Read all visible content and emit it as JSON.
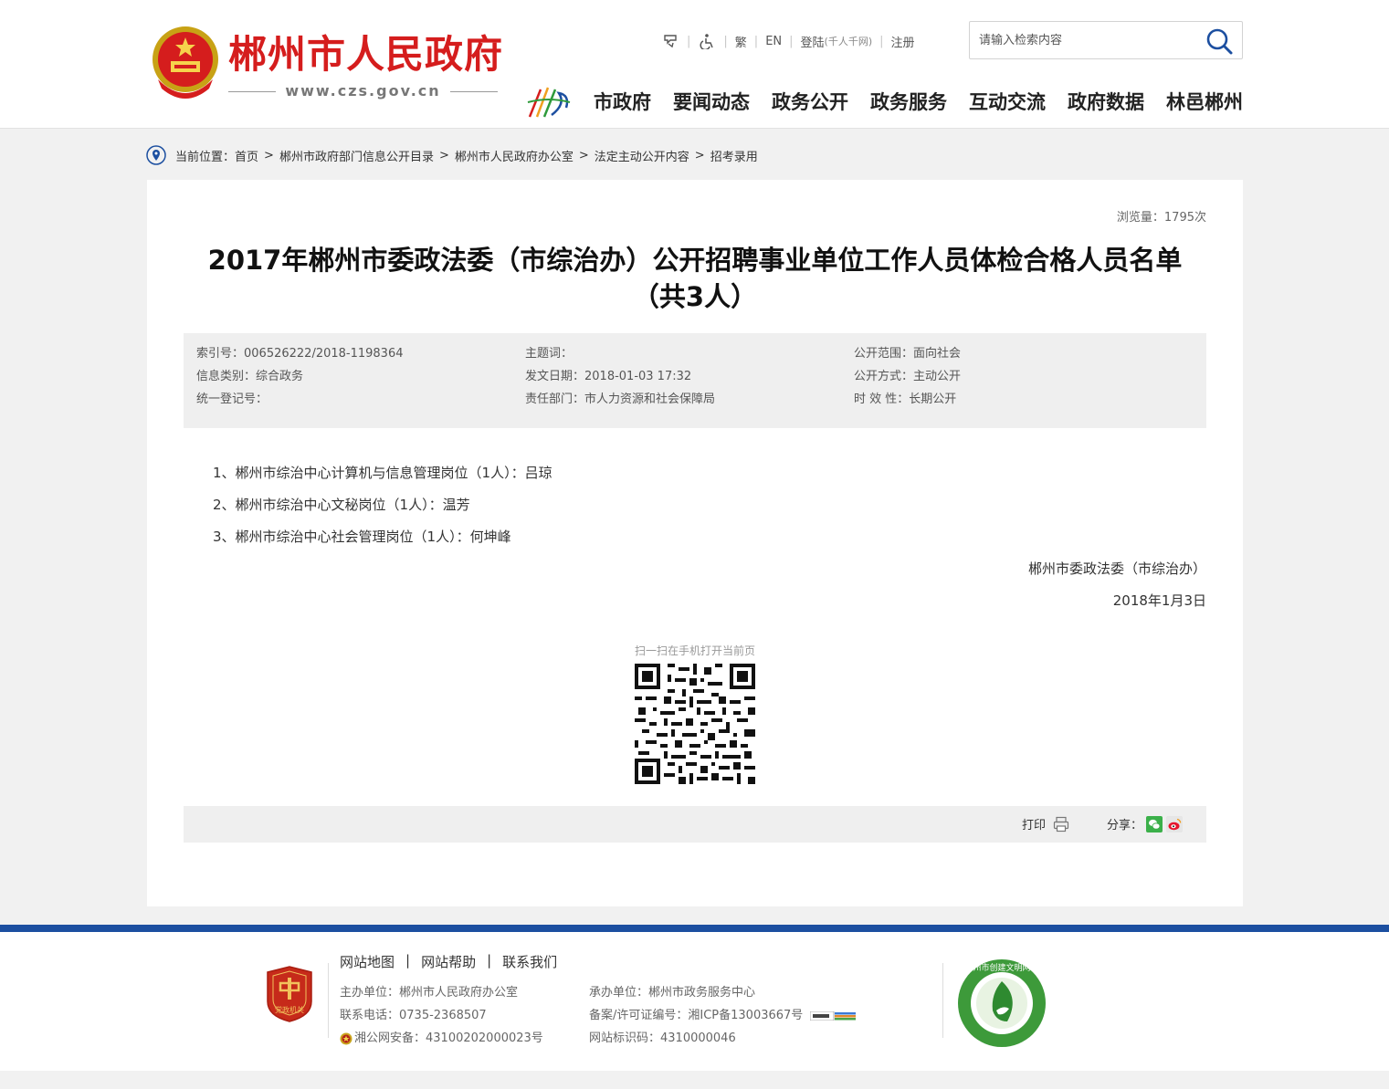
{
  "header": {
    "site_title": "郴州市人民政府",
    "site_url": "www.czs.gov.cn",
    "toolbar": {
      "trad": "繁",
      "en": "EN",
      "login": "登陆",
      "login_note": "(千人千网)",
      "register": "注册"
    },
    "search": {
      "placeholder": "请输入检索内容"
    },
    "nav": [
      "市政府",
      "要闻动态",
      "政务公开",
      "政务服务",
      "互动交流",
      "政府数据",
      "林邑郴州"
    ]
  },
  "breadcrumb": {
    "label": "当前位置：",
    "items": [
      "首页",
      "郴州市政府部门信息公开目录",
      "郴州市人民政府办公室",
      "法定主动公开内容",
      "招考录用"
    ],
    "separator": ">"
  },
  "article": {
    "views": "浏览量：1795次",
    "title_line1": "2017年郴州市委政法委（市综治办）公开招聘事业单位工作人员体检合格人员名单",
    "title_line2": "（共3人）",
    "meta": {
      "index_no": "索引号：006526222/2018-1198364",
      "info_category": "信息类别：综合政务",
      "registration_no": "统一登记号：",
      "subject": "主题词：",
      "issue_date": "发文日期：2018-01-03 17:32",
      "department": "责任部门：市人力资源和社会保障局",
      "scope": "公开范围：面向社会",
      "method": "公开方式：主动公开",
      "validity": "时 效 性：长期公开"
    },
    "items": [
      "1、郴州市综治中心计算机与信息管理岗位（1人）：吕琼",
      "2、郴州市综治中心文秘岗位（1人）：温芳",
      "3、郴州市综治中心社会管理岗位（1人）：何坤峰"
    ],
    "signature": "郴州市委政法委（市综治办）",
    "date": "2018年1月3日",
    "qr_label": "扫一扫在手机打开当前页",
    "print_label": "打印",
    "share_label": "分享："
  },
  "footer": {
    "links": [
      "网站地图",
      "网站帮助",
      "联系我们"
    ],
    "link_sep": "|",
    "host": "主办单位：郴州市人民政府办公室",
    "phone": "联系电话：0735-2368507",
    "police": "湘公网安备：43100202000023号",
    "operator": "承办单位：郴州市政务服务中心",
    "icp": "备案/许可证编号：湘ICP备13003667号",
    "site_id": "网站标识码：4310000046",
    "badge_left_text": "党政机关",
    "badge_right_text": "郴州市创建文明网站"
  },
  "colors": {
    "brand_red": "#d51d1d",
    "footer_blue": "#1c4fa0"
  }
}
